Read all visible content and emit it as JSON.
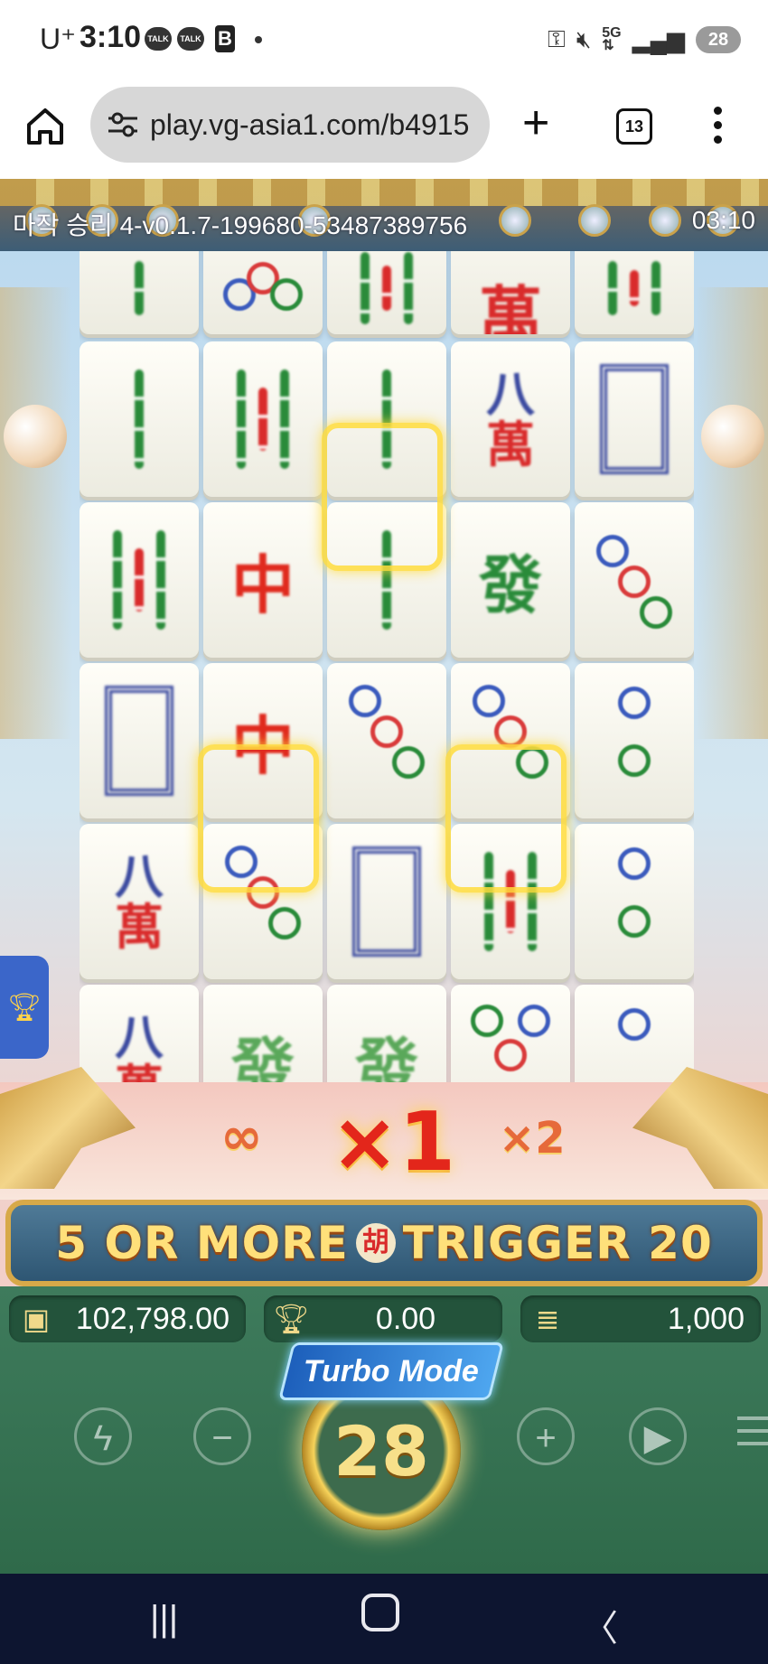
{
  "status_bar": {
    "carrier": "U⁺",
    "time": "3:10",
    "talk1": "TALK",
    "talk2": "TALK",
    "b_icon": "B",
    "battery": "28",
    "icons": [
      "key-icon",
      "mute-icon",
      "5g-icon",
      "signal-icon"
    ]
  },
  "browser": {
    "url": "play.vg-asia1.com/b4915",
    "tab_count": "13",
    "new_tab": "+"
  },
  "game": {
    "version": "마작 승리 4-v0.1.7-199680-53487389756",
    "time": "03:10",
    "multipliers": {
      "infinite": "∞",
      "current": "×1",
      "next": "×2"
    },
    "banner": {
      "left": "5 OR MORE",
      "hu_glyph": "胡",
      "right": "TRIGGER 20"
    },
    "balance": "102,798.00",
    "win": "0.00",
    "bet": "1,000",
    "turbo_label": "Turbo Mode",
    "spin_count": "28",
    "controls": {
      "minus": "−",
      "plus": "+"
    },
    "tiles": [
      [
        "bam3",
        "dots3",
        "bam3",
        "wan",
        "bam3"
      ],
      [
        "bam1",
        "bam4",
        "bam2",
        "wan8",
        "white"
      ],
      [
        "bam4",
        "zhong",
        "bam2",
        "fa",
        "dots3"
      ],
      [
        "white",
        "zhong",
        "dots3",
        "dots3",
        "dots2"
      ],
      [
        "wan8",
        "dots3",
        "white",
        "bam4",
        "dots2"
      ],
      [
        "wan8",
        "fa",
        "fa",
        "dots4",
        "dots2"
      ]
    ]
  },
  "colors": {
    "panel": "#2f6a4a",
    "banner": "#2e5673",
    "accent": "#ffe07a",
    "navbar": "#0d1530"
  }
}
